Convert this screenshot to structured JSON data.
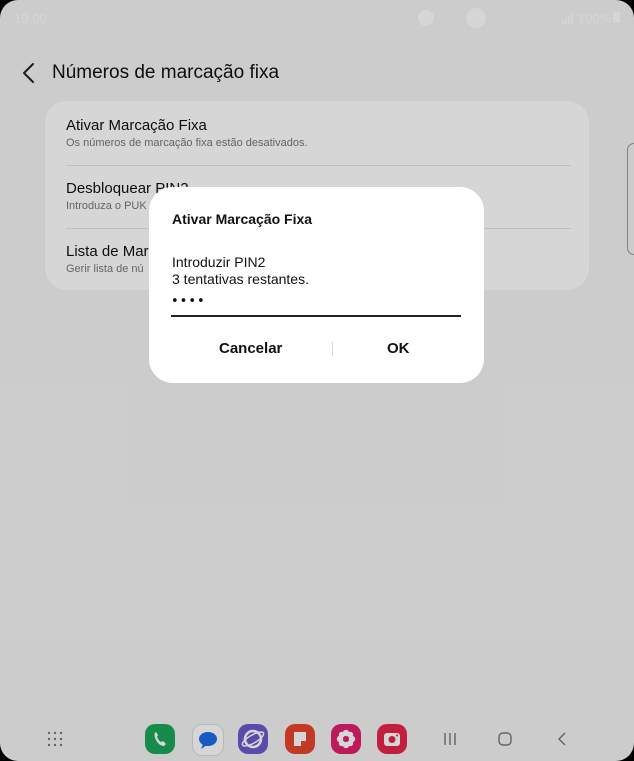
{
  "status_bar": {
    "time": "10.00",
    "battery": "100%"
  },
  "header": {
    "title": "Números de marcação fixa"
  },
  "settings": {
    "items": [
      {
        "title": "Ativar Marcação Fixa",
        "subtitle": "Os números de marcação fixa estão desativados."
      },
      {
        "title": "Desbloquear PIN2",
        "subtitle": "Introduza o PUK"
      },
      {
        "title": "Lista de Mar",
        "subtitle": "Gerir lista de nú"
      }
    ]
  },
  "dialog": {
    "title": "Ativar Marcação Fixa",
    "label": "Introduzir PIN2",
    "attempts": "3 tentativas restantes.",
    "pin_value": "••••",
    "cancel_label": "Cancelar",
    "ok_label": "OK"
  },
  "dock": {
    "apps": [
      {
        "name": "phone-icon",
        "color": "#1ba65a"
      },
      {
        "name": "messages-icon",
        "color": "#ffffff"
      },
      {
        "name": "internet-icon",
        "color": "#6a5acd"
      },
      {
        "name": "notes-icon",
        "color": "#e8442e"
      },
      {
        "name": "gallery-icon",
        "color": "#e0206c"
      },
      {
        "name": "camera-icon",
        "color": "#e8264a"
      }
    ]
  }
}
